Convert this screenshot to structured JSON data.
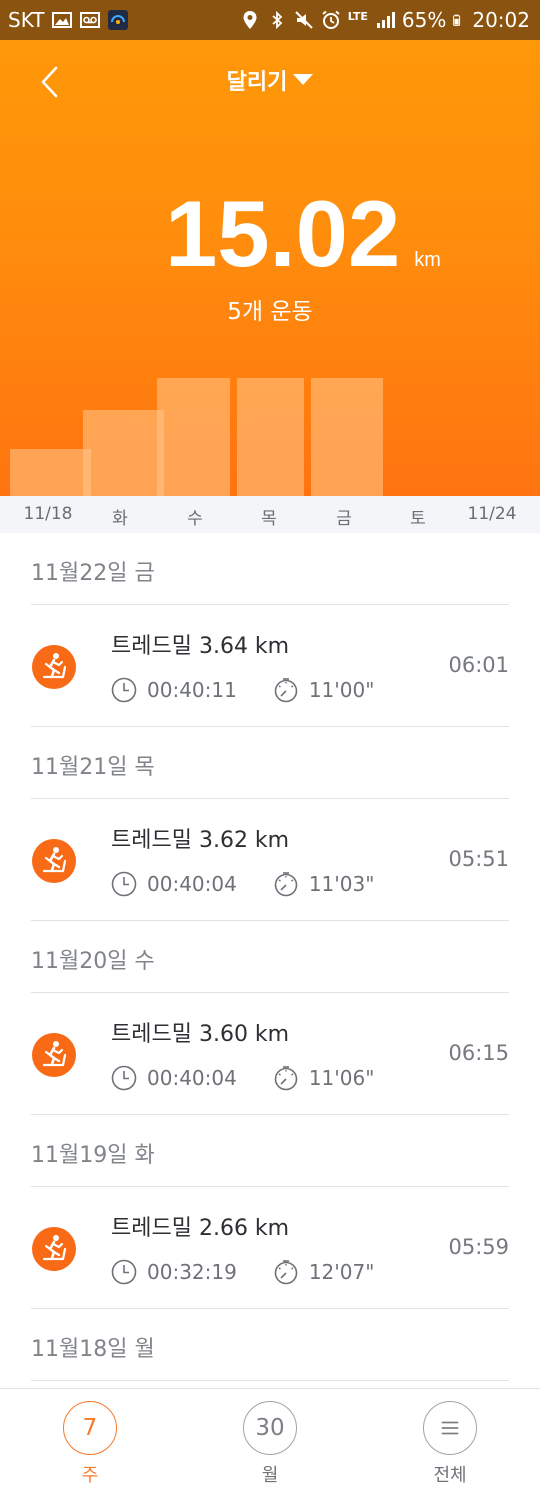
{
  "status_bar": {
    "carrier": "SKT",
    "network": "LTE",
    "battery": "65%",
    "time": "20:02"
  },
  "header": {
    "title": "달리기",
    "total_distance": "15.02",
    "distance_unit": "km",
    "workout_count": "5개 운동",
    "bar_levels": [
      0.4,
      0.73,
      1.0,
      1.0,
      1.0
    ]
  },
  "day_axis": [
    "11/18",
    "화",
    "수",
    "목",
    "금",
    "토",
    "11/24"
  ],
  "days": [
    {
      "date": "11월22일 금",
      "entries": [
        {
          "name": "트레드밀 3.64 km",
          "duration": "00:40:11",
          "pace": "11'00\"",
          "time": "06:01"
        }
      ]
    },
    {
      "date": "11월21일 목",
      "entries": [
        {
          "name": "트레드밀 3.62 km",
          "duration": "00:40:04",
          "pace": "11'03\"",
          "time": "05:51"
        }
      ]
    },
    {
      "date": "11월20일 수",
      "entries": [
        {
          "name": "트레드밀 3.60 km",
          "duration": "00:40:04",
          "pace": "11'06\"",
          "time": "06:15"
        }
      ]
    },
    {
      "date": "11월19일 화",
      "entries": [
        {
          "name": "트레드밀 2.66 km",
          "duration": "00:32:19",
          "pace": "12'07\"",
          "time": "05:59"
        }
      ]
    },
    {
      "date": "11월18일 월",
      "entries": []
    }
  ],
  "bottom_nav": [
    {
      "number": "7",
      "label": "주",
      "active": true
    },
    {
      "number": "30",
      "label": "월",
      "active": false
    },
    {
      "number": "",
      "label": "전체",
      "active": false
    }
  ],
  "colors": {
    "accent": "#f77a2a",
    "header_top": "#ff9808",
    "header_bottom": "#ff7411",
    "icon_bg": "#f96a16"
  },
  "icons": {
    "activity": "treadmill-icon",
    "duration": "clock-icon",
    "pace": "stopwatch-icon"
  }
}
